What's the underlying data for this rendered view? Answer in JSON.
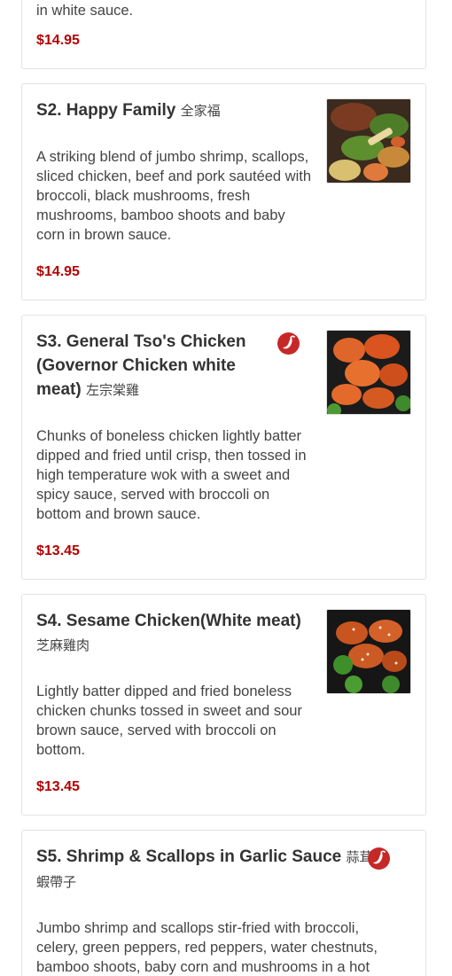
{
  "colors": {
    "price": "#b30000",
    "spicy": "#c62828",
    "border": "#e3e3e3"
  },
  "items": [
    {
      "title": "",
      "cn": "",
      "desc": "in white sauce.",
      "price": "$14.95"
    },
    {
      "title": "S2. Happy Family",
      "cn": "全家福",
      "desc": "A striking blend of jumbo shrimp, scallops, sliced chicken, beef and pork sautéed with broccoli, black mushrooms, fresh mushrooms, bamboo shoots and baby corn in brown sauce.",
      "price": "$14.95",
      "spicy": false,
      "image": "happy-family-photo"
    },
    {
      "title": "S3. General Tso's Chicken (Governor Chicken white meat)",
      "cn": "左宗棠雞",
      "desc": "Chunks of boneless chicken lightly batter dipped and fried until crisp, then tossed in high temperature wok with a sweet and spicy sauce, served with broccoli on bottom and brown sauce.",
      "price": "$13.45",
      "spicy": true,
      "image": "general-tso-photo"
    },
    {
      "title": "S4. Sesame Chicken(White meat)",
      "cn": "芝麻雞肉",
      "desc": "Lightly batter dipped and fried boneless chicken chunks tossed in sweet and sour brown sauce, served with broccoli on bottom.",
      "price": "$13.45",
      "spicy": false,
      "image": "sesame-chicken-photo"
    },
    {
      "title": "S5. Shrimp & Scallops in Garlic Sauce",
      "cn": "蒜茸蝦帶子",
      "desc": "Jumbo shrimp and scallops stir-fried with broccoli, celery, green peppers, red peppers, water chestnuts, bamboo shoots, baby corn and mushrooms in a hot",
      "price": "",
      "spicy": true,
      "icon": "chili-pepper-icon"
    }
  ]
}
